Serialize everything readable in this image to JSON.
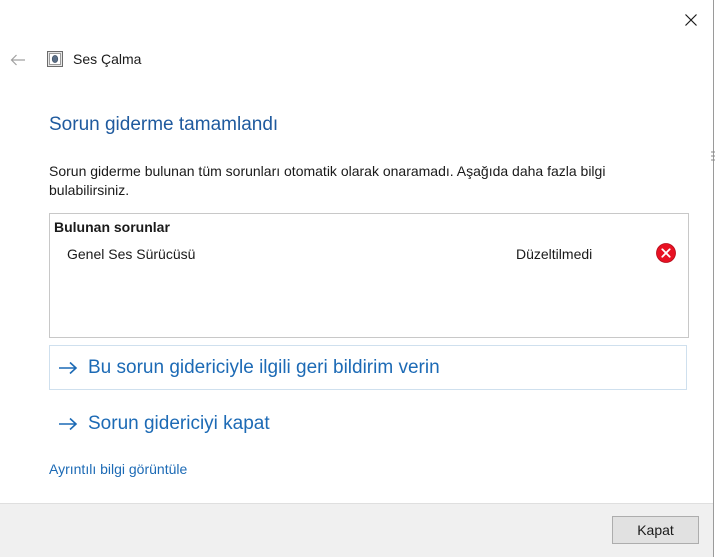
{
  "window": {
    "title": "Ses Çalma",
    "back_icon": "arrow-left-icon",
    "app_icon": "speaker-app-icon",
    "close_icon": "close-icon"
  },
  "main": {
    "heading": "Sorun giderme tamamlandı",
    "description": "Sorun giderme bulunan tüm sorunları otomatik olarak onaramadı. Aşağıda daha fazla bilgi bulabilirsiniz.",
    "problems": {
      "header": "Bulunan sorunlar",
      "items": [
        {
          "name": "Genel Ses Sürücüsü",
          "status": "Düzeltilmedi",
          "status_icon": "error-x-icon",
          "status_color": "#e81123"
        }
      ]
    },
    "actions": [
      {
        "label": "Bu sorun gidericiyle ilgili geri bildirim verin",
        "icon": "arrow-right-icon"
      },
      {
        "label": "Sorun gidericiyi kapat",
        "icon": "arrow-right-icon"
      }
    ],
    "details_link": "Ayrıntılı bilgi görüntüle"
  },
  "footer": {
    "close_button": "Kapat"
  },
  "colors": {
    "heading": "#1f5a9e",
    "link": "#1c6ab5",
    "error": "#e81123",
    "footer_bg": "#f0f0f0"
  }
}
